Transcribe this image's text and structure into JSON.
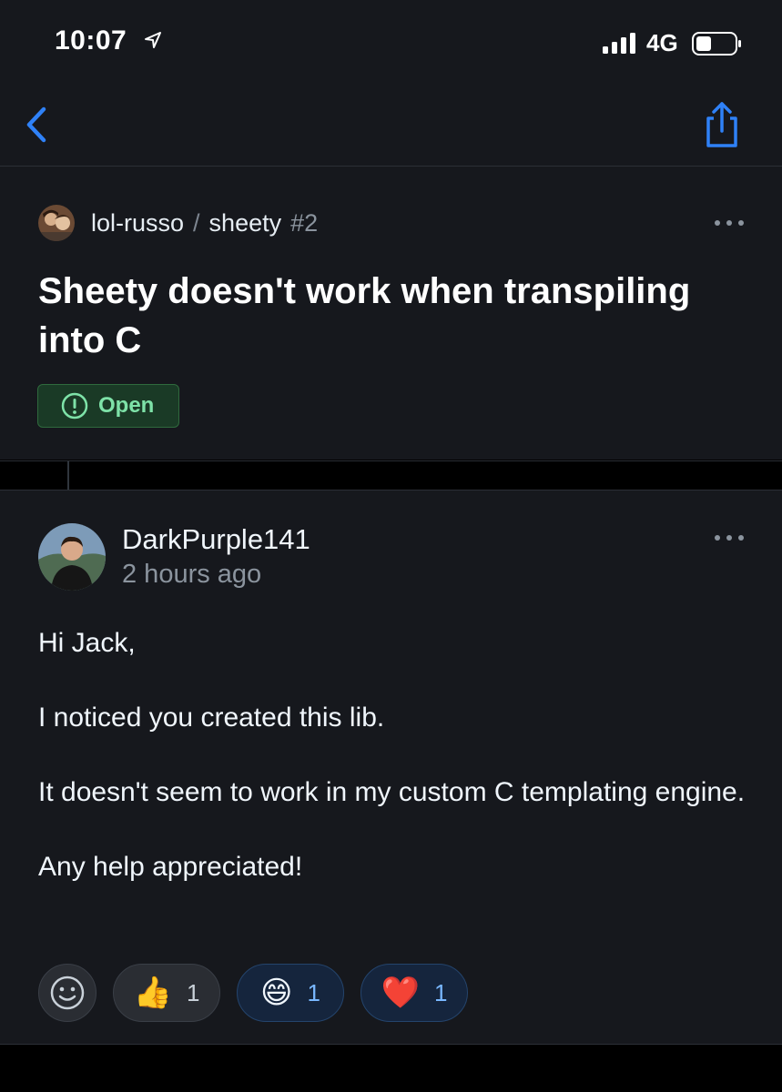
{
  "status_bar": {
    "time": "10:07",
    "network": "4G",
    "icons": [
      "location-arrow-icon",
      "signal-bars-icon",
      "battery-icon"
    ]
  },
  "nav": {
    "back_icon": "chevron-left-icon",
    "share_icon": "share-icon",
    "accent_color": "#2f81f7"
  },
  "issue": {
    "repo_owner": "lol-russo",
    "separator": "/",
    "repo_name": "sheety",
    "number": "#2",
    "title": "Sheety doesn't work when transpiling into C",
    "status": "Open",
    "status_color": "#7ee2a8",
    "more_icon": "ellipsis-icon"
  },
  "comment": {
    "author": "DarkPurple141",
    "time": "2 hours ago",
    "paragraphs": [
      "Hi Jack,",
      "I noticed you created this lib.",
      "It doesn't seem to work in my custom C templating engine.",
      "Any help appreciated!"
    ],
    "reactions": [
      {
        "emoji": "👍",
        "name": "thumbs-up",
        "count": "1",
        "reacted": false
      },
      {
        "emoji": "😄",
        "name": "laugh",
        "count": "1",
        "reacted": true
      },
      {
        "emoji": "❤️",
        "name": "heart",
        "count": "1",
        "reacted": true
      }
    ]
  },
  "colors": {
    "background": "#16181d",
    "text": "#f0f6fc",
    "muted": "#8b949e"
  }
}
